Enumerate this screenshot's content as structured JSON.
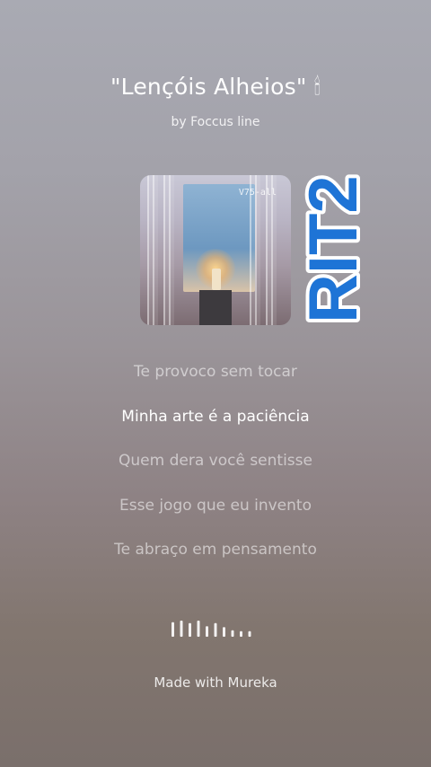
{
  "song": {
    "title": "\"Lençóis Alheios\" 🕯",
    "artist": "by Foccus line"
  },
  "cover": {
    "watermark": "V75-all"
  },
  "sticker": {
    "text": "RIT2",
    "fill_color": "#1e74d6",
    "outline_color": "#ffffff"
  },
  "lyrics": [
    {
      "text": "Te provoco sem tocar",
      "active": false
    },
    {
      "text": "Minha arte é a paciência",
      "active": true
    },
    {
      "text": "Quem dera você sentisse",
      "active": false
    },
    {
      "text": "Esse jogo que eu invento",
      "active": false
    },
    {
      "text": "Te abraço em pensamento",
      "active": false
    }
  ],
  "waveform": {
    "icon": "audio-waveform-icon",
    "levels": [
      0.9,
      1.0,
      0.85,
      1.0,
      0.65,
      0.85,
      0.6,
      0.4,
      0.35,
      0.35
    ]
  },
  "footer": {
    "text": "Made with Mureka"
  },
  "colors": {
    "text_primary": "#ffffff",
    "text_dim": "rgba(255,255,255,0.55)"
  }
}
